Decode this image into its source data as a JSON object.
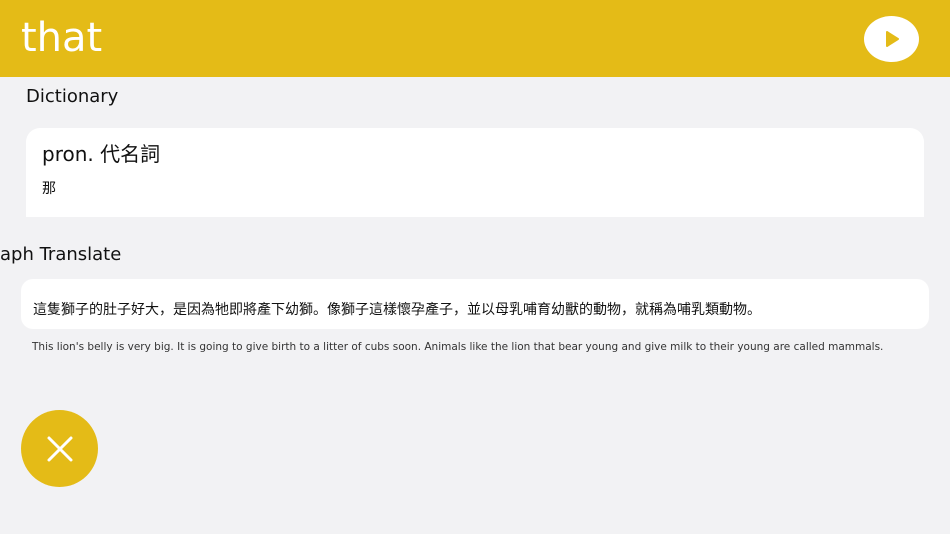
{
  "header": {
    "word": "that",
    "play_icon": "play-icon",
    "accent": "#e4bb17"
  },
  "dictionary": {
    "label": "Dictionary",
    "part_of_speech": "pron. 代名詞",
    "meaning": "那"
  },
  "paragraph_translate": {
    "label": "aph Translate",
    "chinese": "這隻獅子的肚子好大，是因為牠即將產下幼獅。像獅子這樣懷孕產子，並以母乳哺育幼獸的動物，就稱為哺乳類動物。",
    "english": "This lion's belly is very big. It is going to give birth to a litter of cubs soon. Animals like the lion that bear young and give milk to their young are called mammals."
  },
  "controls": {
    "close_icon": "close-icon"
  }
}
